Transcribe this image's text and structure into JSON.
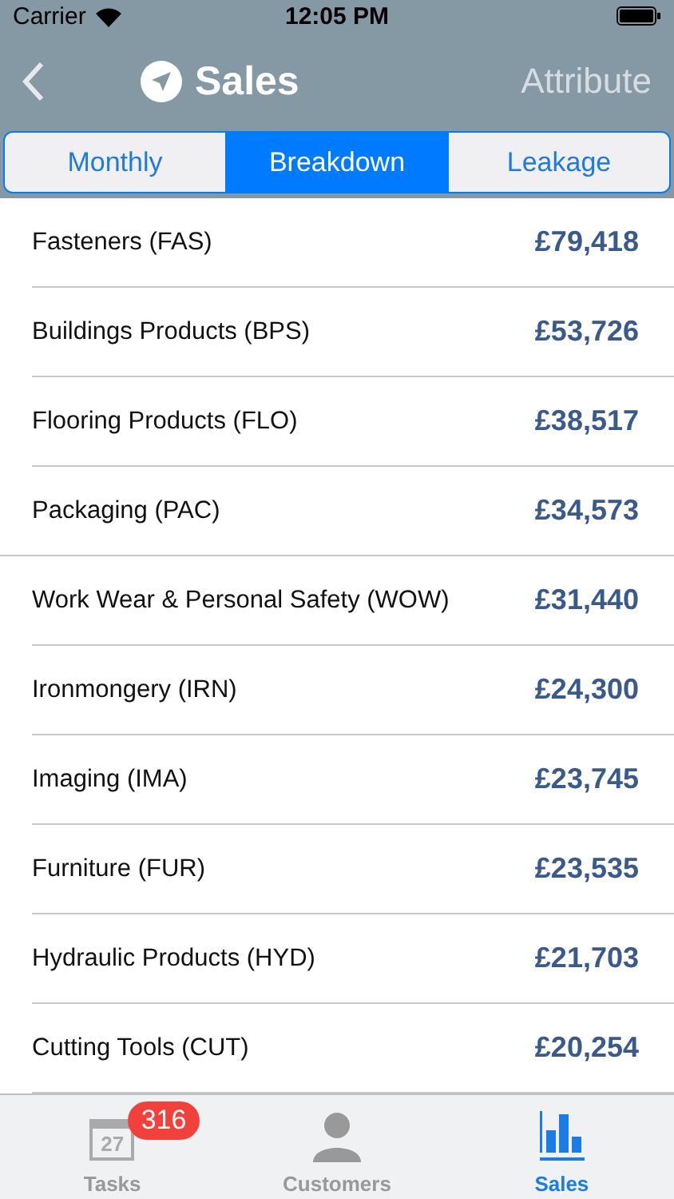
{
  "status_bar": {
    "carrier": "Carrier",
    "time": "12:05 PM"
  },
  "nav": {
    "title": "Sales",
    "action": "Attribute"
  },
  "segments": [
    {
      "label": "Monthly",
      "selected": false
    },
    {
      "label": "Breakdown",
      "selected": true
    },
    {
      "label": "Leakage",
      "selected": false
    }
  ],
  "rows": [
    {
      "name": "Fasteners (FAS)",
      "value": "£79,418"
    },
    {
      "name": "Buildings Products (BPS)",
      "value": "£53,726"
    },
    {
      "name": "Flooring Products (FLO)",
      "value": "£38,517"
    },
    {
      "name": "Packaging (PAC)",
      "value": "£34,573"
    },
    {
      "name": "Work Wear & Personal Safety (WOW)",
      "value": "£31,440"
    },
    {
      "name": "Ironmongery (IRN)",
      "value": "£24,300"
    },
    {
      "name": "Imaging (IMA)",
      "value": "£23,745"
    },
    {
      "name": "Furniture (FUR)",
      "value": "£23,535"
    },
    {
      "name": "Hydraulic Products (HYD)",
      "value": "£21,703"
    },
    {
      "name": "Cutting Tools (CUT)",
      "value": "£20,254"
    }
  ],
  "tabs": [
    {
      "kind": "calendar",
      "label": "Tasks",
      "icon_day": "27",
      "badge": "316",
      "selected": false
    },
    {
      "kind": "person",
      "label": "Customers",
      "selected": false
    },
    {
      "kind": "chart",
      "label": "Sales",
      "selected": true
    }
  ]
}
